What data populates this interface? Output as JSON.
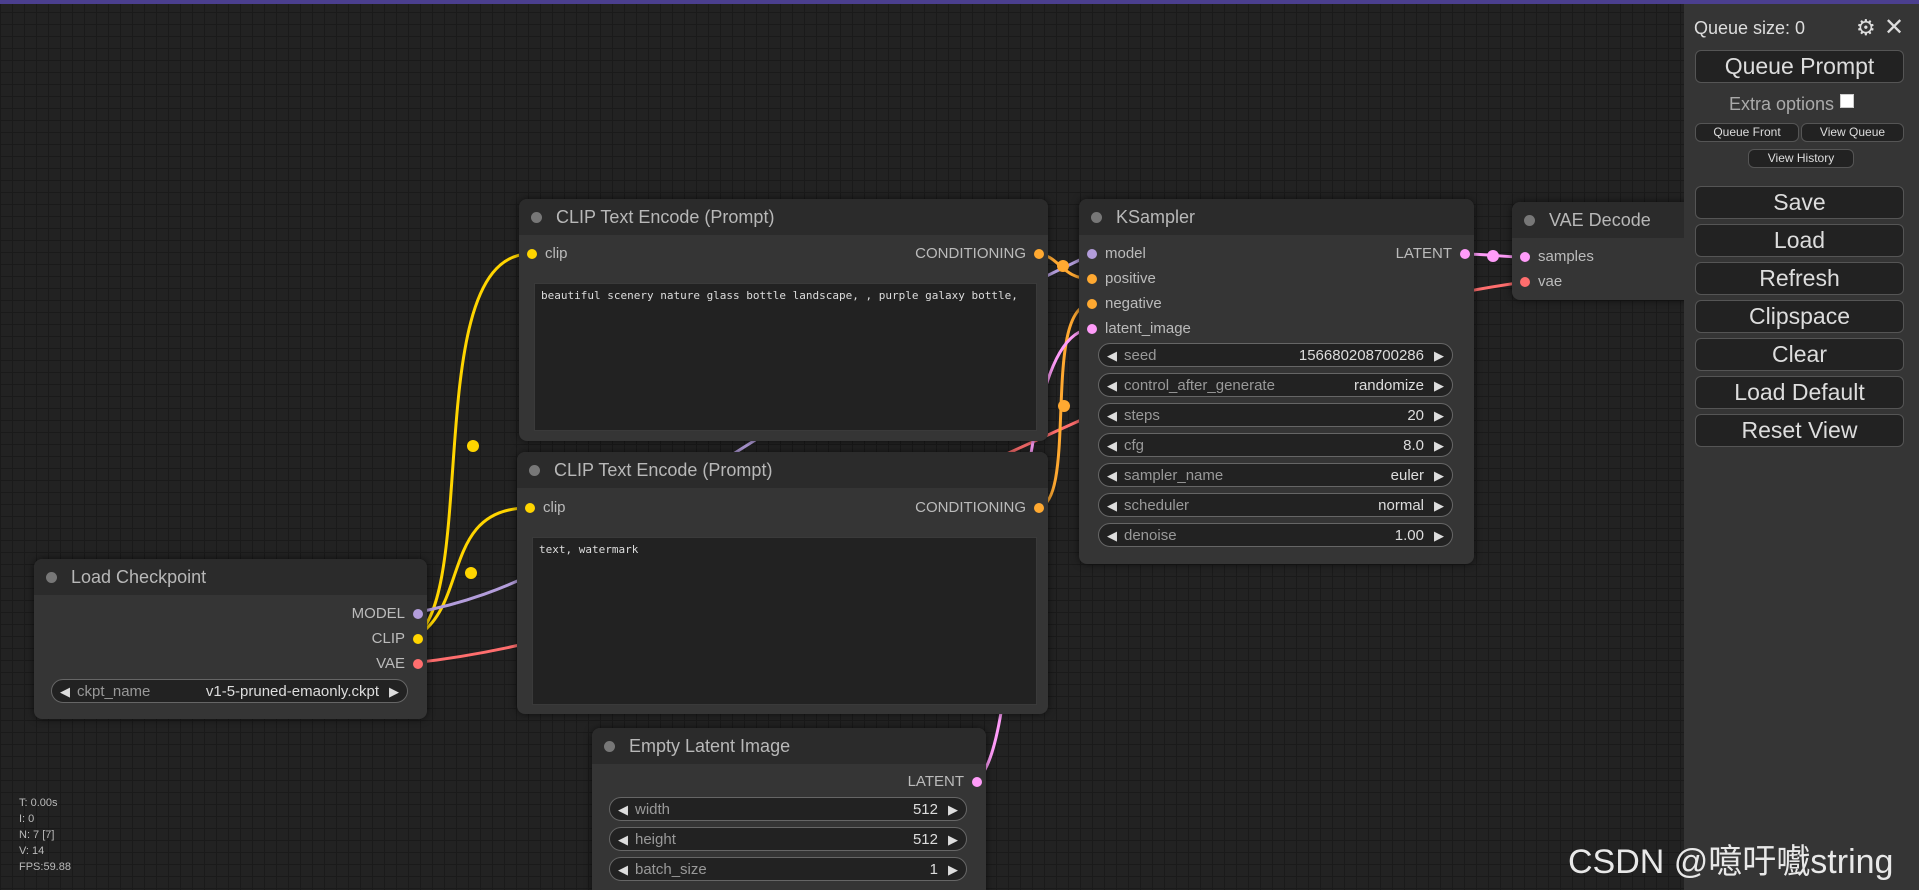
{
  "colors": {
    "clip": "#ffd500",
    "model": "#b39ddb",
    "vae": "#ff6e6e",
    "conditioning": "#ffa931",
    "latent": "#ff9cf9"
  },
  "nodes": {
    "clip_pos": {
      "title": "CLIP Text Encode (Prompt)",
      "input_clip": "clip",
      "output": "CONDITIONING",
      "text": "beautiful scenery nature glass bottle landscape, , purple galaxy bottle,"
    },
    "clip_neg": {
      "title": "CLIP Text Encode (Prompt)",
      "input_clip": "clip",
      "output": "CONDITIONING",
      "text": "text, watermark"
    },
    "ksampler": {
      "title": "KSampler",
      "inputs": [
        "model",
        "positive",
        "negative",
        "latent_image"
      ],
      "output": "LATENT",
      "widgets": [
        {
          "name": "seed",
          "value": "156680208700286"
        },
        {
          "name": "control_after_generate",
          "value": "randomize"
        },
        {
          "name": "steps",
          "value": "20"
        },
        {
          "name": "cfg",
          "value": "8.0"
        },
        {
          "name": "sampler_name",
          "value": "euler"
        },
        {
          "name": "scheduler",
          "value": "normal"
        },
        {
          "name": "denoise",
          "value": "1.00"
        }
      ]
    },
    "vae_decode": {
      "title": "VAE Decode",
      "inputs": [
        "samples",
        "vae"
      ]
    },
    "load_checkpoint": {
      "title": "Load Checkpoint",
      "outputs": [
        "MODEL",
        "CLIP",
        "VAE"
      ],
      "widget": {
        "name": "ckpt_name",
        "value": "v1-5-pruned-emaonly.ckpt"
      }
    },
    "empty_latent": {
      "title": "Empty Latent Image",
      "output": "LATENT",
      "widgets": [
        {
          "name": "width",
          "value": "512"
        },
        {
          "name": "height",
          "value": "512"
        },
        {
          "name": "batch_size",
          "value": "1"
        }
      ]
    }
  },
  "menu": {
    "queue_size": "Queue size: 0",
    "queue_prompt": "Queue Prompt",
    "extra_options": "Extra options",
    "queue_front": "Queue Front",
    "view_queue": "View Queue",
    "view_history": "View History",
    "buttons": [
      "Save",
      "Load",
      "Refresh",
      "Clipspace",
      "Clear",
      "Load Default",
      "Reset View"
    ]
  },
  "stats": [
    "T: 0.00s",
    "I: 0",
    "N: 7 [7]",
    "V: 14",
    "FPS:59.88"
  ],
  "watermark": "CSDN @噫吁嚱string",
  "icons": [
    "gear-icon",
    "close-icon",
    "arrow-left-icon",
    "arrow-right-icon"
  ]
}
